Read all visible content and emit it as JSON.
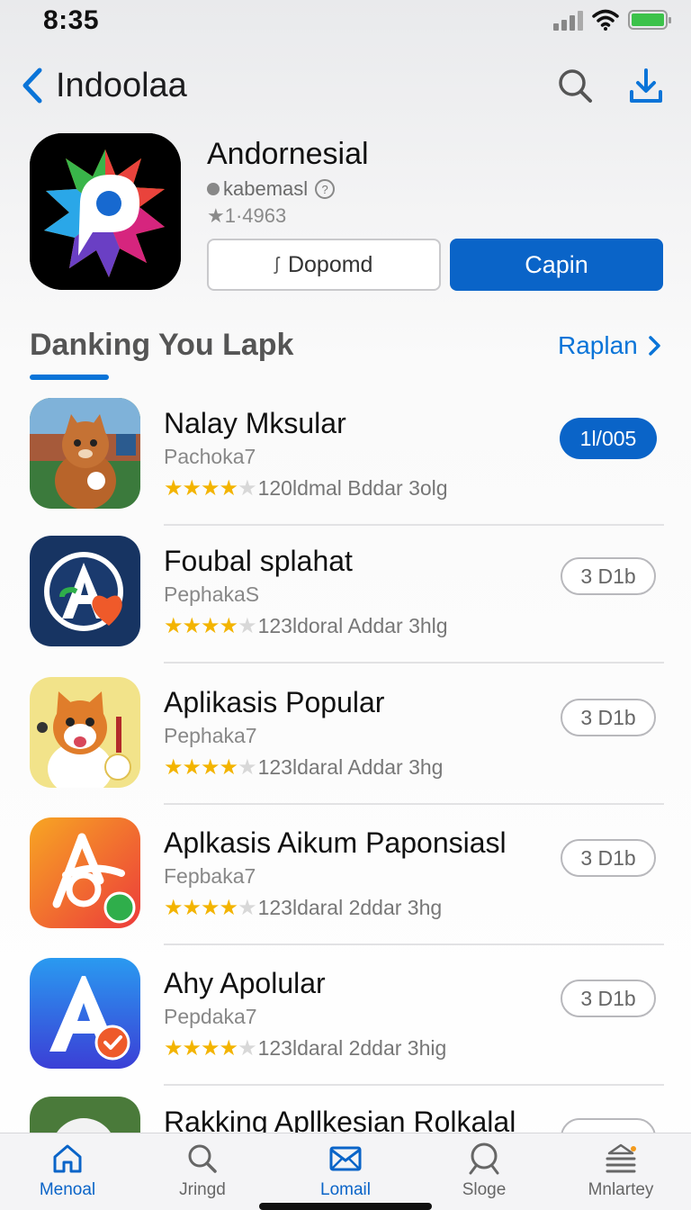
{
  "status_bar": {
    "time": "8:35"
  },
  "nav": {
    "title": "Indoolaa"
  },
  "featured": {
    "name": "Andornesial",
    "developer": "kabemasl",
    "rating": "1·4963",
    "button_secondary": "Dopomd",
    "button_primary": "Capin"
  },
  "section": {
    "title": "Danking You Lapk",
    "link": "Raplan"
  },
  "apps": [
    {
      "name": "Nalay Mksular",
      "subtitle": "Pachoka7",
      "rating_text": "120ldmal Bddar 3olg",
      "stars": 4.5,
      "action": "1l/005",
      "action_active": true
    },
    {
      "name": "Foubal splahat",
      "subtitle": "PephakaS",
      "rating_text": "123ldoral Addar 3hlg",
      "stars": 4.5,
      "action": "3 D1b",
      "action_active": false
    },
    {
      "name": "Aplikasis Popular",
      "subtitle": "Pephaka7",
      "rating_text": "123ldaral Addar 3hg",
      "stars": 4.5,
      "action": "3 D1b",
      "action_active": false
    },
    {
      "name": "Aplkasis Aikum Paponsiasl",
      "subtitle": "Fepbaka7",
      "rating_text": "123ldaral 2ddar 3hg",
      "stars": 4.5,
      "action": "3 D1b",
      "action_active": false
    },
    {
      "name": "Ahy Apolular",
      "subtitle": "Pepdaka7",
      "rating_text": "123ldaral 2ddar 3hig",
      "stars": 4.5,
      "action": "3 D1b",
      "action_active": false
    },
    {
      "name": "Rakking Apllkesian Rolkalal",
      "subtitle": "",
      "rating_text": "",
      "stars": 0,
      "action": "",
      "action_active": false
    }
  ],
  "tabs": [
    {
      "label": "Menoal",
      "icon": "home-icon",
      "active": true
    },
    {
      "label": "Jringd",
      "icon": "search-icon",
      "active": false
    },
    {
      "label": "Lomail",
      "icon": "mail-icon",
      "active": true
    },
    {
      "label": "Sloge",
      "icon": "search-icon",
      "active": false
    },
    {
      "label": "Mnlartey",
      "icon": "menu-icon",
      "active": false
    }
  ],
  "colors": {
    "accent": "#0a64c8",
    "link": "#0a74d8",
    "star": "#f3b400"
  }
}
